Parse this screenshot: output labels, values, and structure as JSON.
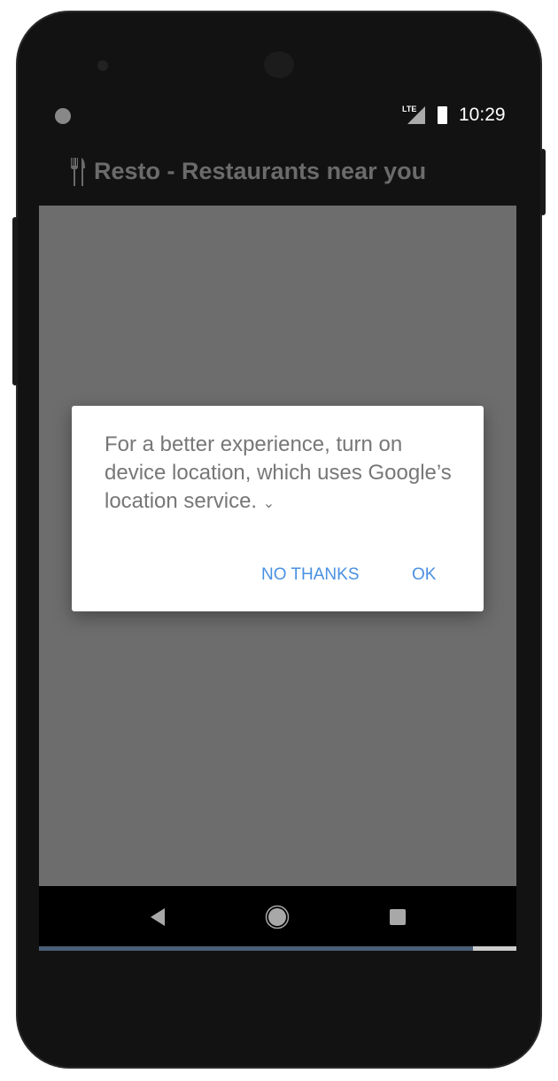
{
  "status_bar": {
    "network": "LTE",
    "time": "10:29",
    "icons": [
      "notification-dot-icon",
      "lte-signal-icon",
      "battery-icon"
    ]
  },
  "app_bar": {
    "icon": "fork-knife-icon",
    "title": "Resto - Restaurants near you"
  },
  "dialog": {
    "message": "For a better experience, turn on device location, which uses Google’s location service.",
    "expand_icon": "chevron-down-icon",
    "no_thanks_label": "NO THANKS",
    "ok_label": "OK",
    "accent": "#4a90e2"
  },
  "nav_bar": {
    "buttons": [
      "back-icon",
      "home-icon",
      "recents-icon"
    ]
  },
  "progress": {
    "percent": 91
  }
}
